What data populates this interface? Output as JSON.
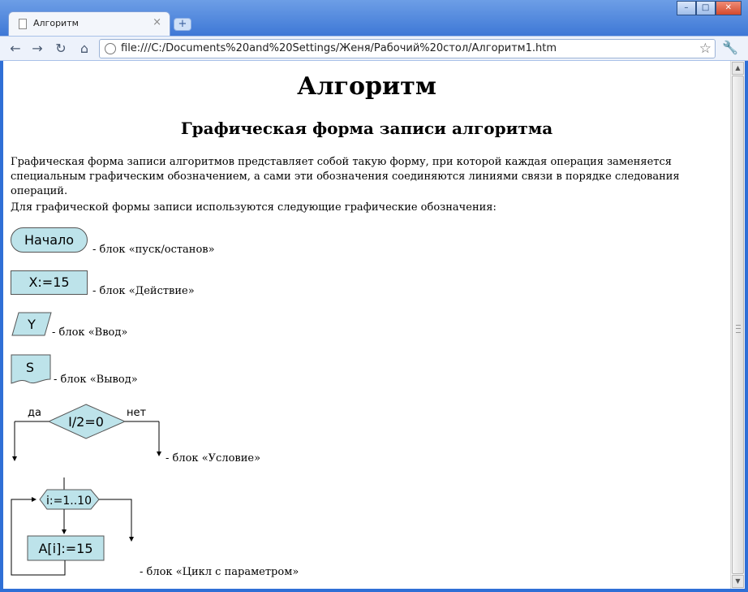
{
  "browser": {
    "tab_title": "Алгоритм",
    "tab_close": "×",
    "new_tab": "+",
    "url": "file:///C:/Documents%20and%20Settings/Женя/Рабочий%20стол/Алгоритм1.htm",
    "window_controls": [
      "–",
      "□",
      "✕"
    ],
    "toolbar_icons": [
      "back-icon",
      "forward-icon",
      "reload-icon",
      "home-icon",
      "star-icon",
      "wrench-icon"
    ]
  },
  "page": {
    "title": "Алгоритм",
    "section_title": "Графическая форма записи алгоритма",
    "paragraph1": "Графическая форма записи алгоритмов представляет собой такую форму, при которой каждая операция заменяется специальным графическим обозначением, а сами эти обозначения соединяются линиями связи в порядке следования операций.",
    "paragraph2": "Для графической формы записи используются следующие графические обозначения:",
    "blocks": {
      "terminal": {
        "text": "Начало",
        "label": "- блок «пуск/останов»"
      },
      "action": {
        "text": "X:=15",
        "label": "- блок «Действие»"
      },
      "input": {
        "text": "Y",
        "label": "- блок «Ввод»"
      },
      "output": {
        "text": "S",
        "label": "- блок «Вывод»"
      },
      "condition": {
        "text": "I/2=0",
        "yes": "да",
        "no": "нет",
        "label": "- блок «Условие»"
      },
      "loop": {
        "header": "i:=1..10",
        "body": "A[i]:=15",
        "label": "- блок «Цикл с параметром»"
      }
    }
  },
  "colors": {
    "block_fill": "#bde3ea",
    "window_blue": "#2f6fd6"
  }
}
